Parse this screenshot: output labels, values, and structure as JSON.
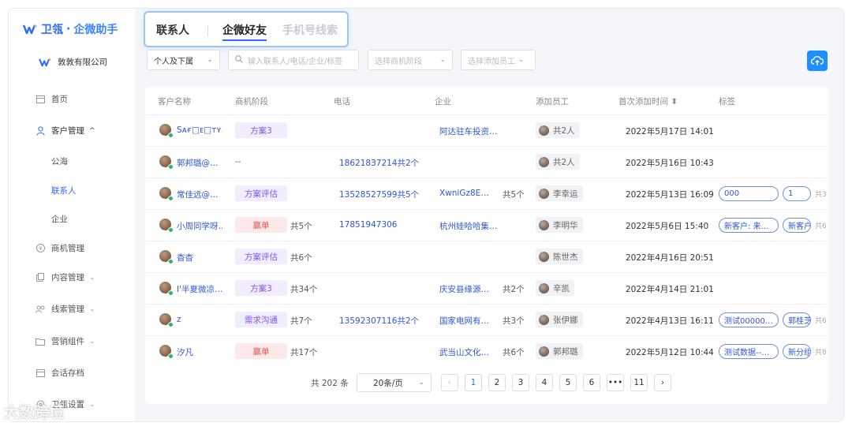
{
  "app": {
    "brand_left": "卫瓴",
    "brand_dot": "·",
    "brand_right": "企微助手",
    "company": "敦敦有限公司"
  },
  "nav": [
    {
      "label": "首页",
      "icon": "home-icon"
    },
    {
      "label": "客户管理",
      "icon": "user-icon",
      "expanded": true
    },
    {
      "label": "商机管理",
      "icon": "yen-icon"
    },
    {
      "label": "内容管理",
      "icon": "content-icon"
    },
    {
      "label": "线索管理",
      "icon": "lead-icon"
    },
    {
      "label": "营销组件",
      "icon": "folder-icon"
    },
    {
      "label": "会话存档",
      "icon": "archive-icon"
    },
    {
      "label": "卫瓴设置",
      "icon": "settings-icon"
    }
  ],
  "subnav": [
    "公海",
    "联系人",
    "企业"
  ],
  "tabs": [
    "联系人",
    "企微好友",
    "手机号线索"
  ],
  "filters": {
    "scope": "个人及下属",
    "search_placeholder": "输入联系人/电话/企业/标签",
    "stage_placeholder": "选择商机阶段",
    "staff_placeholder": "选择添加员工"
  },
  "columns": [
    "客户名称",
    "商机阶段",
    "电话",
    "企业",
    "添加员工",
    "首次添加时间 ⬍",
    "标签"
  ],
  "rows": [
    {
      "name": "Sᴀғ□ᴇ□ᴛʏ...",
      "stage": "方案3",
      "stage_color": "purple",
      "stage_count": "",
      "phone": "",
      "enterprise": "阿达驻车投资…",
      "ent_count": "",
      "staff": "共2人",
      "time": "2022年5月17日 14:01",
      "tags": []
    },
    {
      "name": "郭邦璐@…",
      "stage": "--",
      "stage_color": "",
      "stage_count": "",
      "phone": "18621837214共2个",
      "enterprise": "",
      "ent_count": "",
      "staff": "共2人",
      "time": "2022年5月16日 10:43",
      "tags": []
    },
    {
      "name": "常佳远@…",
      "stage": "方案评估",
      "stage_color": "purple",
      "stage_count": "",
      "phone": "13528527599共5个",
      "enterprise": "XwniGz8E…",
      "ent_count": "共5个",
      "staff": "李幸运",
      "time": "2022年5月13日 16:09",
      "tags": [
        "000",
        "1"
      ],
      "tag_count": "共3"
    },
    {
      "name": "小周同学呀…",
      "stage": "赢单",
      "stage_color": "red",
      "stage_count": "共5个",
      "phone": "17851947306",
      "enterprise": "杭州娃哈哈集…",
      "ent_count": "",
      "staff": "李明华",
      "time": "2022年5月6日 15:40",
      "tags": [
        "新客户: 来…",
        "新客户"
      ],
      "tag_count": "共6"
    },
    {
      "name": "杳杳",
      "stage": "方案评估",
      "stage_color": "purple",
      "stage_count": "共6个",
      "phone": "",
      "enterprise": "",
      "ent_count": "",
      "staff": "陈世杰",
      "time": "2022年4月16日 20:51",
      "tags": []
    },
    {
      "name": "I'半夏微凉…",
      "stage": "方案3",
      "stage_color": "purple",
      "stage_count": "共34个",
      "phone": "",
      "enterprise": "庆安县缘源…",
      "ent_count": "共2个",
      "staff": "辛凯",
      "time": "2022年4月14日 21:01",
      "tags": []
    },
    {
      "name": "z",
      "stage": "需求沟通",
      "stage_color": "purple",
      "stage_count": "共7个",
      "phone": "13592307116共2个",
      "enterprise": "国家电网有…",
      "ent_count": "共3个",
      "staff": "张伊娜",
      "time": "2022年4月13日 16:11",
      "tags": [
        "测试00000…",
        "郭桂芝"
      ],
      "tag_count": "共6"
    },
    {
      "name": "汐凡",
      "stage": "赢单",
      "stage_color": "red",
      "stage_count": "共17个",
      "phone": "",
      "enterprise": "武当山文化…",
      "ent_count": "共6个",
      "staff": "郭邦璐",
      "time": "2022年5月12日 10:44",
      "tags": [
        "测试数据--…",
        "新分组"
      ],
      "tag_count": "共8"
    }
  ],
  "pagination": {
    "total": "共 202 条",
    "page_size": "20条/页",
    "pages": [
      "1",
      "2",
      "3",
      "4",
      "5",
      "6",
      "•••",
      "11"
    ],
    "current": "1",
    "prev": "‹",
    "next": "›"
  },
  "watermark": "大数跨境",
  "colors": {
    "accent": "#2f6bff",
    "upload_button": "#1f8fff",
    "stage_purple": "#7e57e8",
    "stage_red": "#e05252"
  }
}
